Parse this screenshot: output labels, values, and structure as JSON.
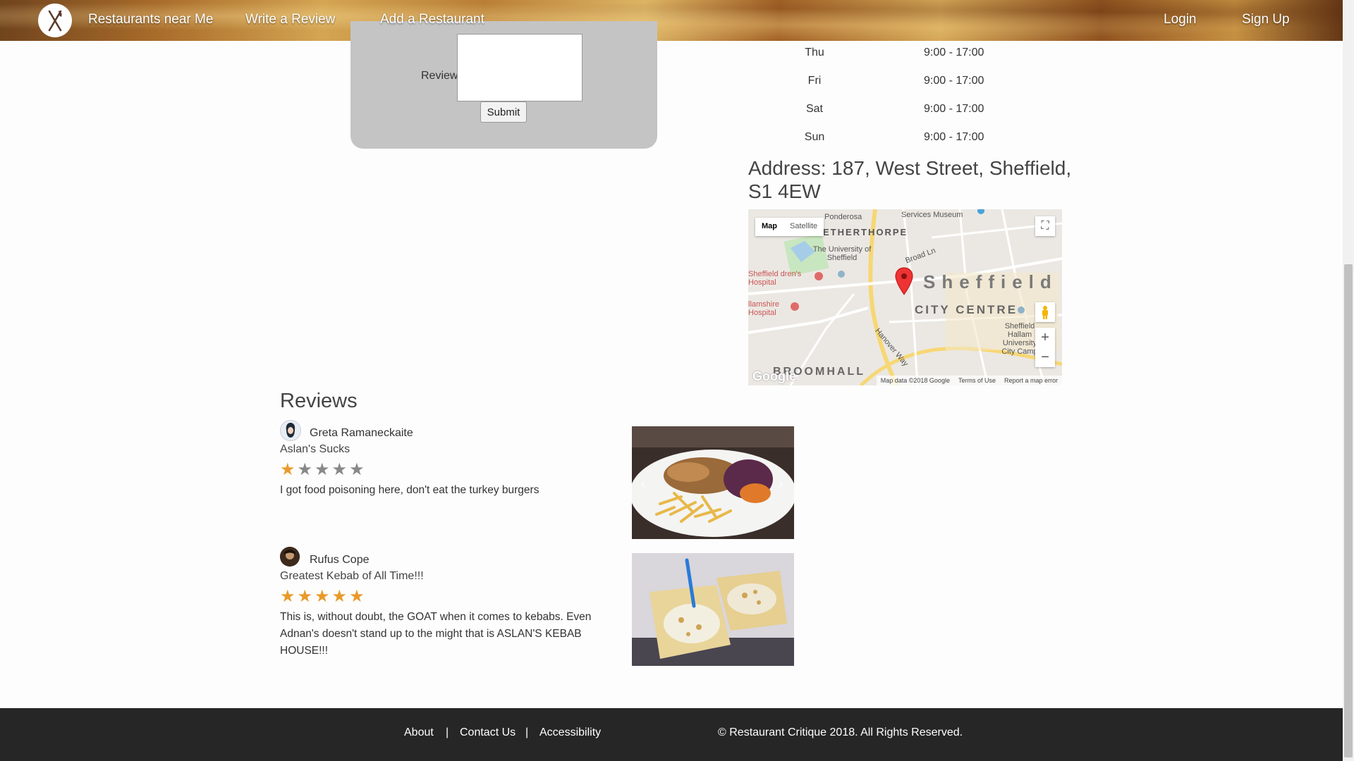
{
  "nav": {
    "restaurants": "Restaurants near Me",
    "write_review": "Write a Review",
    "add_restaurant": "Add a Restaurant",
    "login": "Login",
    "signup": "Sign Up"
  },
  "form": {
    "review_label": "Review",
    "review_value": "",
    "submit_label": "Submit"
  },
  "hours": [
    {
      "day": "Thu",
      "time": "9:00 - 17:00"
    },
    {
      "day": "Fri",
      "time": "9:00 - 17:00"
    },
    {
      "day": "Sat",
      "time": "9:00 - 17:00"
    },
    {
      "day": "Sun",
      "time": "9:00 - 17:00"
    }
  ],
  "address": "Address: 187, West Street, Sheffield, S1 4EW",
  "map": {
    "type_map": "Map",
    "type_satellite": "Satellite",
    "city_label": "Sheffield",
    "centre_label": "CITY CENTRE",
    "area_label": "BROOMHALL",
    "labels": {
      "ponderosa": "Ponderosa",
      "museum": "Services Museum",
      "netherthorpe": "ETHERTHORPE",
      "university": "The University of Sheffield",
      "childrens": "Sheffield dren's Hospital",
      "hallamshire": "llamshire Hospital",
      "hallam": "Sheffield Hallam University City Camp",
      "broad_ln": "Broad Ln",
      "hanover": "Hanover Way"
    },
    "footer_data": "Map data ©2018 Google",
    "footer_terms": "Terms of Use",
    "footer_report": "Report a map error",
    "logo": "Google"
  },
  "reviews_heading": "Reviews",
  "reviews": [
    {
      "name": "Greta Ramaneckaite",
      "title": "Aslan's Sucks",
      "rating": 1,
      "max_rating": 5,
      "body": "I got food poisoning here, don't eat the turkey burgers"
    },
    {
      "name": "Rufus Cope",
      "title": "Greatest Kebab of All Time!!!",
      "rating": 5,
      "max_rating": 5,
      "body": "This is, without doubt, the GOAT when it comes to kebabs. Even Adnan's doesn't stand up to the might that is ASLAN'S KEBAB HOUSE!!!"
    }
  ],
  "footer": {
    "about": "About",
    "contact": "Contact Us",
    "accessibility": "Accessibility",
    "separator": "|",
    "copyright": "© Restaurant Critique 2018. All Rights Reserved."
  },
  "colors": {
    "star_on": "#e89a2a",
    "star_off": "#888888",
    "footer_bg": "#262626",
    "form_bg": "#c4c4c4"
  }
}
